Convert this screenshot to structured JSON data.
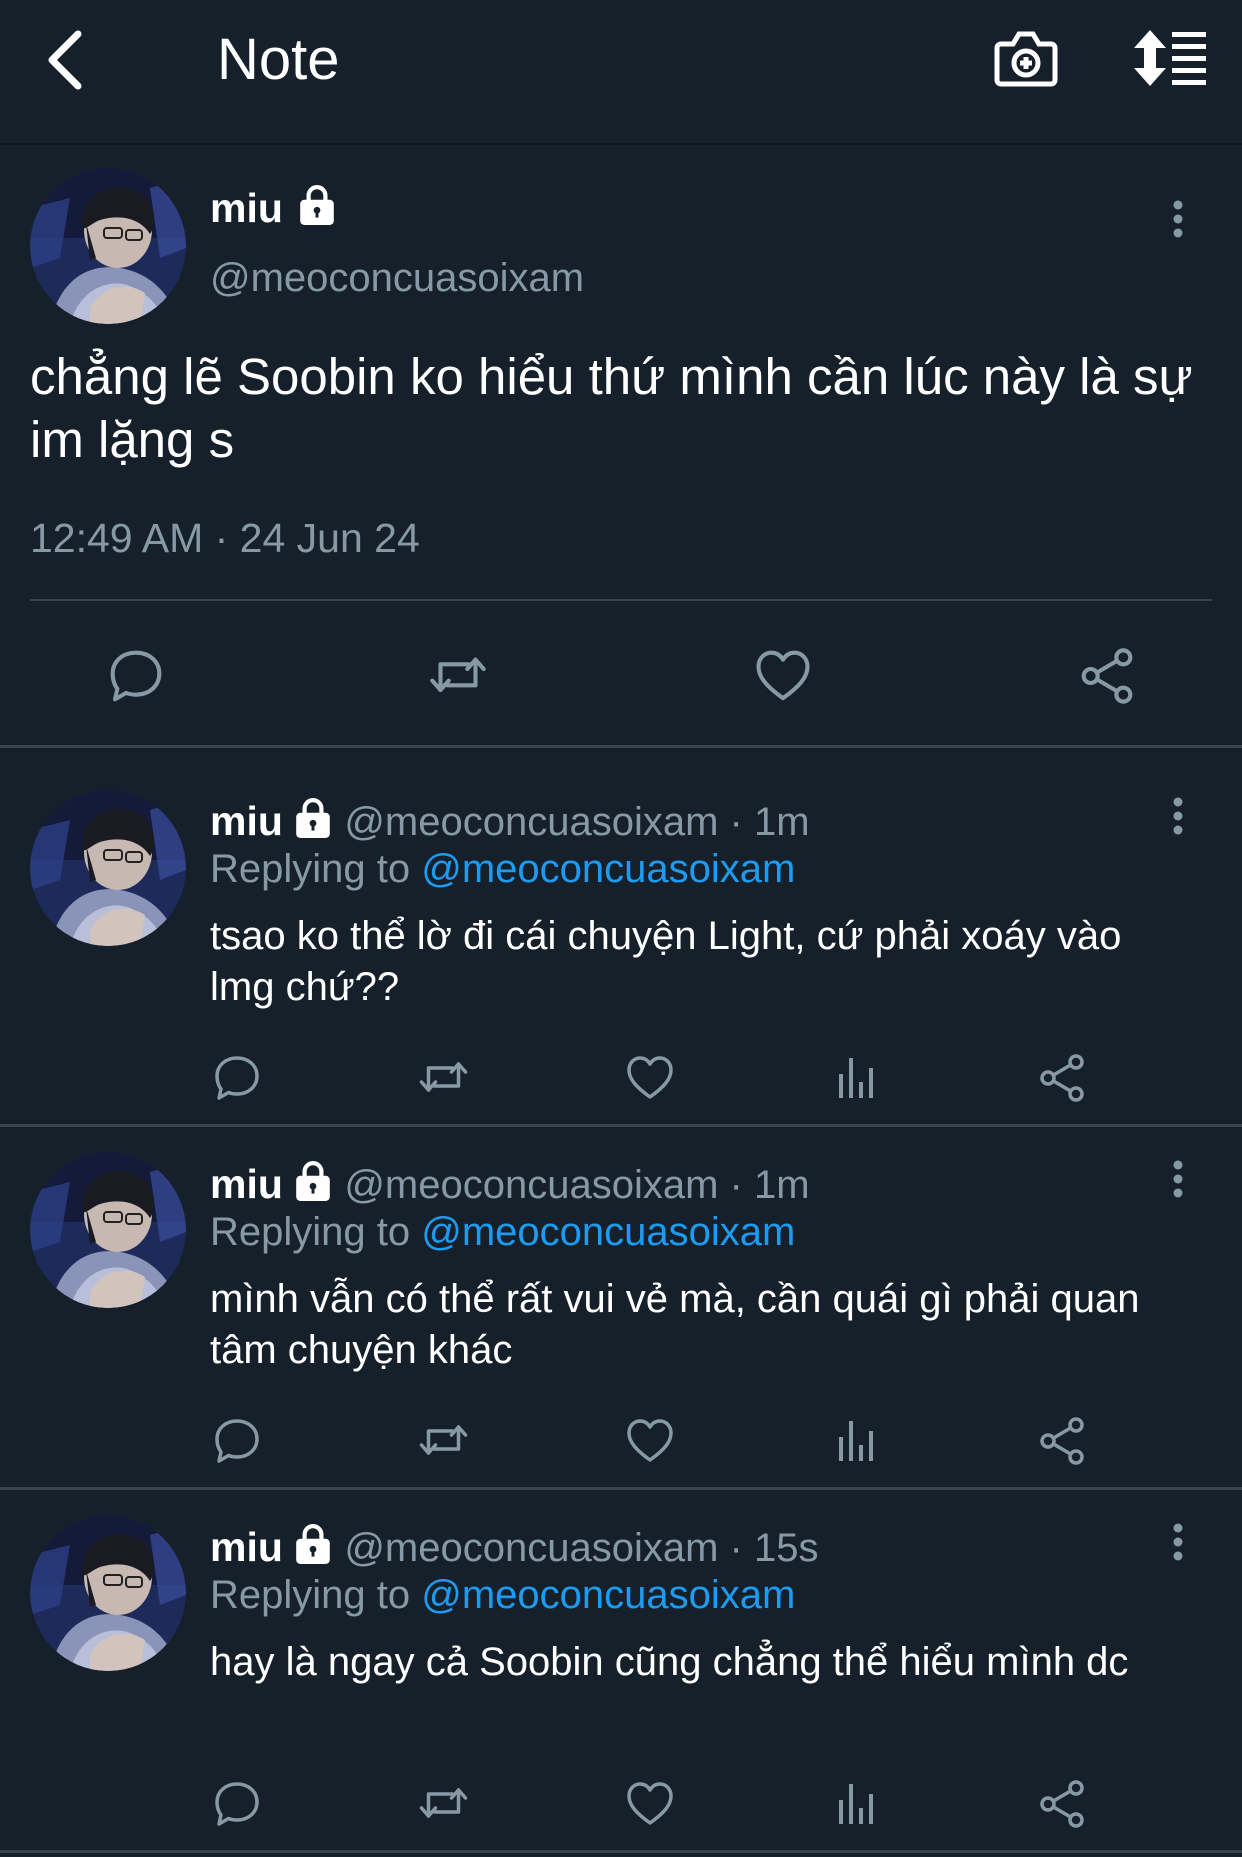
{
  "header": {
    "title": "Note",
    "back_icon": "chevron-left-icon",
    "camera_icon": "camera-add-icon",
    "sort_icon": "sort-list-icon"
  },
  "main_tweet": {
    "name": "miu",
    "handle": "@meoconcuasoixam",
    "text": "chẳng lẽ Soobin ko hiểu thứ mình cần lúc này là sự im lặng s",
    "time": "12:49 AM · 24 Jun 24"
  },
  "replies": [
    {
      "name": "miu",
      "meta": "@meoconcuasoixam · 1m",
      "replying_label": "Replying to ",
      "replying_to": "@meoconcuasoixam",
      "text": "tsao ko thể lờ đi cái chuyện Light, cứ phải xoáy vào lmg chứ??"
    },
    {
      "name": "miu",
      "meta": "@meoconcuasoixam · 1m",
      "replying_label": "Replying to ",
      "replying_to": "@meoconcuasoixam",
      "text": "mình vẫn có thể rất vui vẻ mà, cần quái gì phải quan tâm chuyện khác"
    },
    {
      "name": "miu",
      "meta": "@meoconcuasoixam · 15s",
      "replying_label": "Replying to ",
      "replying_to": "@meoconcuasoixam",
      "text": "hay là ngay cả Soobin cũng chẳng thể hiểu mình dc"
    }
  ],
  "colors": {
    "background": "#15202b",
    "secondary_text": "#8899a6",
    "link": "#1d9bf0",
    "divider": "#38444d"
  }
}
